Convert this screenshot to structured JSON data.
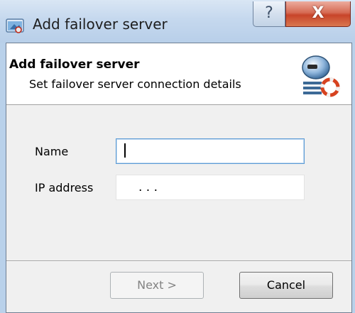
{
  "window": {
    "title": "Add failover server",
    "help_glyph": "?",
    "close_glyph": "X"
  },
  "header": {
    "title": "Add failover server",
    "subtitle": "Set failover server connection details",
    "icon": "server-failover-icon"
  },
  "form": {
    "name_label": "Name",
    "name_value": "",
    "ip_label": "IP address",
    "ip_value": ". . ."
  },
  "buttons": {
    "next_label": "Next >",
    "cancel_label": "Cancel"
  },
  "colors": {
    "title_bar": "#c5d8ee",
    "close_button": "#c8442a",
    "dialog_background": "#f0f0f0",
    "focus_border": "#5b9bd5"
  }
}
